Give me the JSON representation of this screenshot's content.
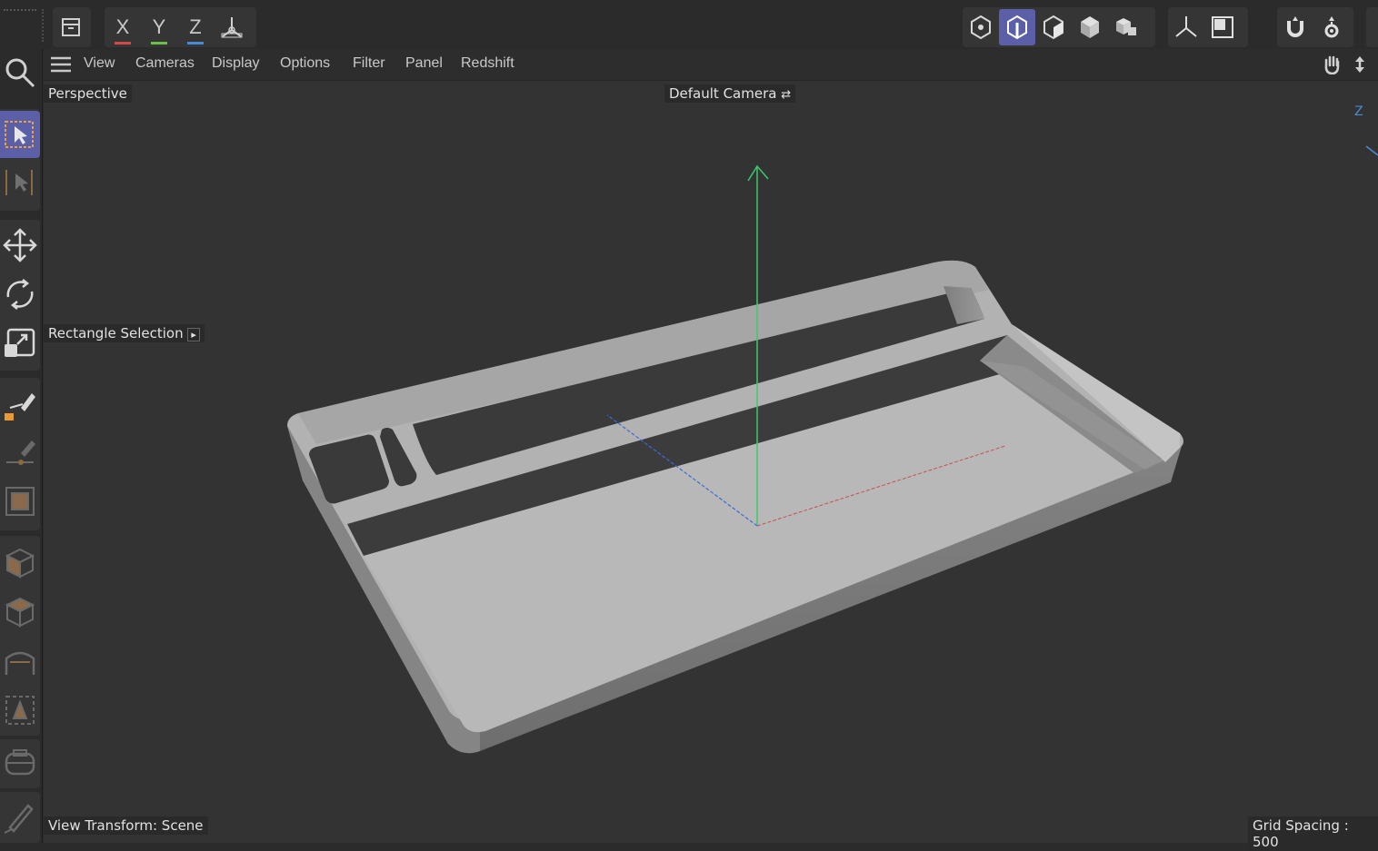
{
  "top_toolbar": {
    "axis_labels": {
      "x": "X",
      "y": "Y",
      "z": "Z"
    },
    "icons": [
      "model-mode-icon",
      "axis-x-icon",
      "axis-y-icon",
      "axis-z-icon",
      "coordinate-system-icon",
      "points-mode-icon",
      "edges-mode-icon",
      "polygons-mode-icon",
      "object-mode-icon",
      "uvw-mode-icon",
      "axis-mode-icon",
      "solo-icon",
      "snap-magnet-icon",
      "settings-gear-icon"
    ]
  },
  "menu": {
    "items": [
      "View",
      "Cameras",
      "Display",
      "Options",
      "Filter",
      "Panel",
      "Redshift"
    ]
  },
  "viewport": {
    "projection_label": "Perspective",
    "camera_label": "Default Camera",
    "tool_label": "Rectangle Selection",
    "view_transform_label": "View Transform: Scene",
    "grid_spacing_label": "Grid Spacing : 500",
    "axis_hint": "Z"
  },
  "colors": {
    "accent_active": "#5a5fa8",
    "axis_x": "#d44a4a",
    "axis_y": "#6cc04a",
    "axis_z": "#4a8ad4",
    "model_surface": "#b4b4b4"
  }
}
